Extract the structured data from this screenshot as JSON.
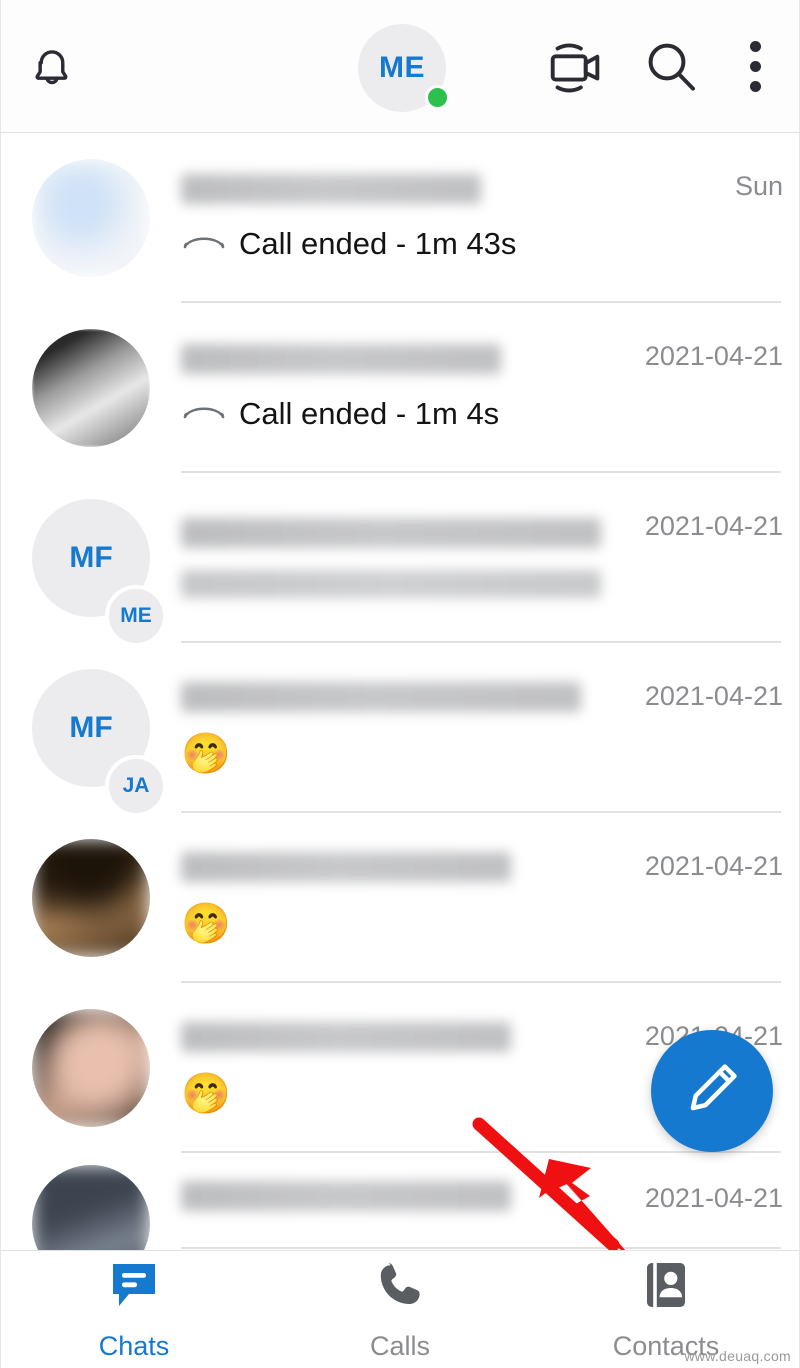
{
  "header": {
    "bell_icon": "notification-bell-icon",
    "video_icon": "video-camera-icon",
    "search_icon": "search-icon",
    "overflow_icon": "more-vertical-icon",
    "avatar": {
      "initials": "ME",
      "status": "online"
    }
  },
  "colors": {
    "accent": "#1579d0",
    "online": "#2ec04c",
    "arrow": "#ef1111",
    "muted_text": "#8a8c8f",
    "avatar_bg": "#ececee"
  },
  "chats": [
    {
      "avatar_type": "photo",
      "name": "",
      "preview": "Call ended - 1m 43s",
      "preview_icon": "call-ended-icon",
      "emoji": "",
      "time": "Sun"
    },
    {
      "avatar_type": "photo",
      "name": "",
      "preview": "Call ended - 1m 4s",
      "preview_icon": "call-ended-icon",
      "emoji": "",
      "time": "2021-04-21"
    },
    {
      "avatar_type": "initials",
      "initials": "MF",
      "badge": "ME",
      "name": "",
      "preview": "",
      "emoji": "",
      "time": "2021-04-21"
    },
    {
      "avatar_type": "initials",
      "initials": "MF",
      "badge": "JA",
      "name": "",
      "preview": "",
      "emoji": "🤭",
      "time": "2021-04-21"
    },
    {
      "avatar_type": "photo",
      "name": "",
      "preview": "",
      "emoji": "🤭",
      "time": "2021-04-21"
    },
    {
      "avatar_type": "photo",
      "name": "",
      "preview": "",
      "emoji": "🤭",
      "time": "2021-04-21"
    },
    {
      "avatar_type": "photo",
      "name": "",
      "preview": "",
      "emoji": "",
      "time": "2021-04-21"
    }
  ],
  "fab": {
    "icon": "compose-pencil-icon"
  },
  "annotation": {
    "type": "arrow",
    "points_to": "Contacts"
  },
  "bottom_nav": {
    "tabs": [
      {
        "label": "Chats",
        "icon": "chat-bubble-icon",
        "active": true
      },
      {
        "label": "Calls",
        "icon": "phone-icon",
        "active": false
      },
      {
        "label": "Contacts",
        "icon": "contacts-book-icon",
        "active": false
      }
    ]
  },
  "watermark": "www.deuaq.com"
}
